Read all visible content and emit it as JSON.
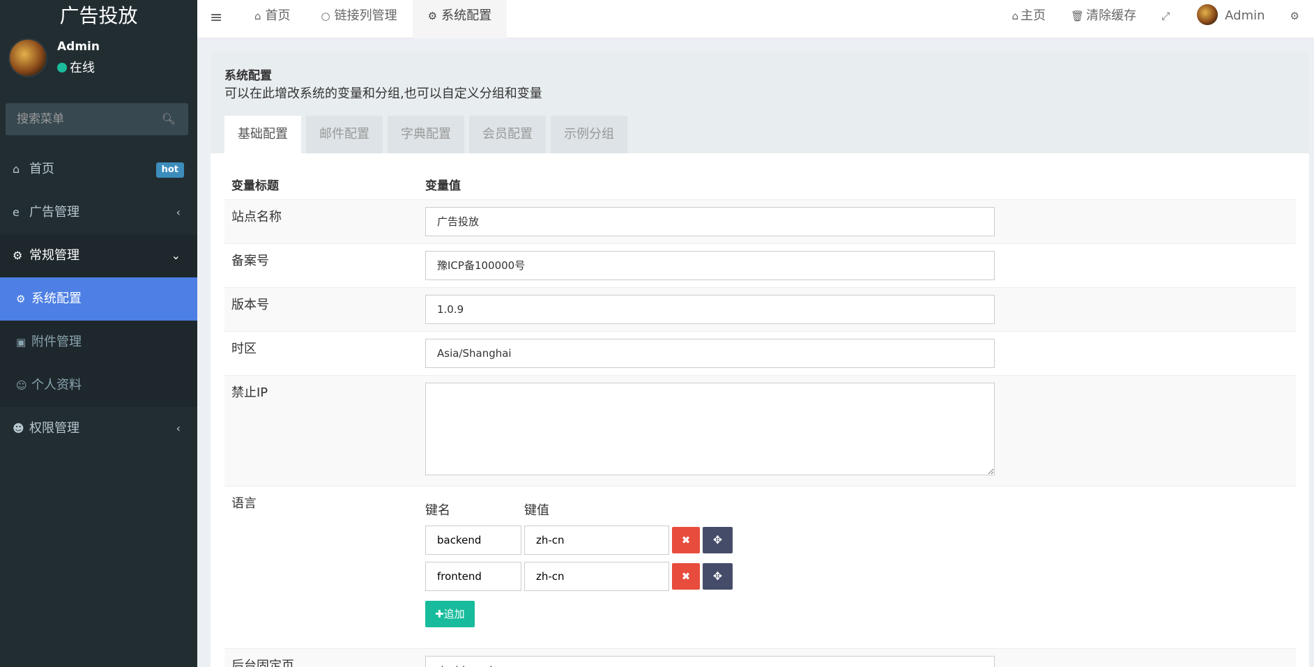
{
  "app": {
    "logo": "广告投放"
  },
  "user": {
    "name": "Admin",
    "status": "在线"
  },
  "search": {
    "placeholder": "搜索菜单",
    "icon": "search-icon"
  },
  "sidebar": {
    "items": [
      {
        "label": "首页",
        "icon": "home-icon",
        "badge": "hot"
      },
      {
        "label": "广告管理",
        "icon": "ie-icon"
      },
      {
        "label": "常规管理",
        "icon": "cogs-icon"
      },
      {
        "label": "权限管理",
        "icon": "users-icon"
      }
    ],
    "sub": [
      {
        "label": "系统配置",
        "icon": "gear-icon"
      },
      {
        "label": "附件管理",
        "icon": "image-icon"
      },
      {
        "label": "个人资料",
        "icon": "user-icon"
      }
    ]
  },
  "topnav": {
    "tabs": [
      {
        "label": "首页",
        "icon": "home-icon"
      },
      {
        "label": "链接列管理",
        "icon": "circle-icon"
      },
      {
        "label": "系统配置",
        "icon": "gear-icon"
      }
    ],
    "home_label": "主页",
    "clear_cache_label": "清除缓存",
    "user_name": "Admin"
  },
  "panel": {
    "title": "系统配置",
    "description": "可以在此增改系统的变量和分组,也可以自定义分组和变量",
    "tabs": [
      "基础配置",
      "邮件配置",
      "字典配置",
      "会员配置",
      "示例分组"
    ]
  },
  "table": {
    "col_title": "变量标题",
    "col_value": "变量值",
    "rows": {
      "site_name": {
        "label": "站点名称",
        "value": "广告投放"
      },
      "beian": {
        "label": "备案号",
        "value": "豫ICP备100000号"
      },
      "version": {
        "label": "版本号",
        "value": "1.0.9"
      },
      "timezone": {
        "label": "时区",
        "value": "Asia/Shanghai"
      },
      "forbid_ip": {
        "label": "禁止IP",
        "value": ""
      },
      "language": {
        "label": "语言",
        "key_header": "键名",
        "value_header": "键值",
        "pairs": [
          {
            "key": "backend",
            "value": "zh-cn"
          },
          {
            "key": "frontend",
            "value": "zh-cn"
          }
        ],
        "add_label": "追加"
      },
      "fixed_page": {
        "label": "后台固定页",
        "value": "dashboard"
      }
    }
  },
  "colors": {
    "sidebar": "#222d32",
    "active": "#4d7fe4",
    "danger": "#e74c3c",
    "success": "#18bc9c",
    "dark_btn": "#444c69"
  }
}
